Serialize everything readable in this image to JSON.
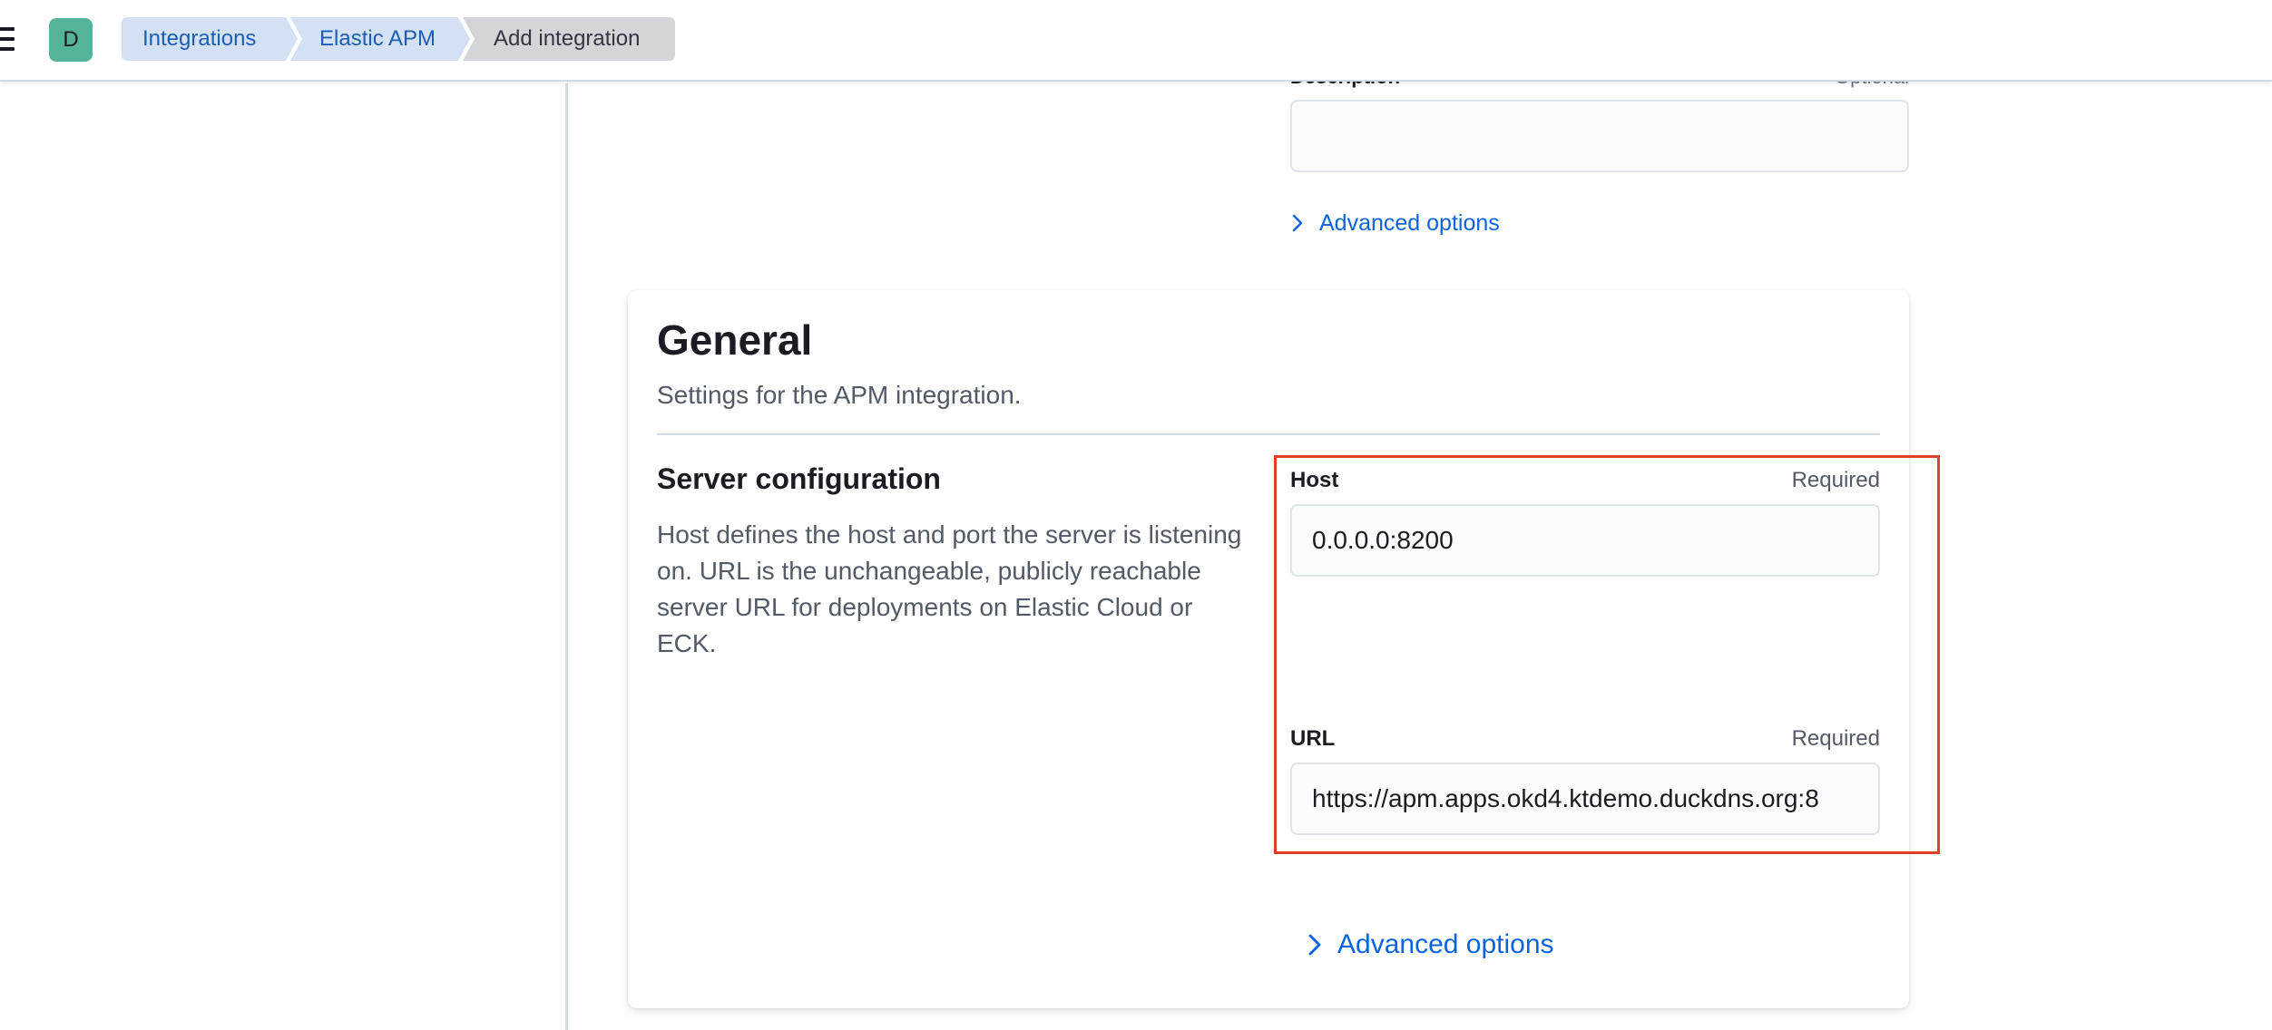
{
  "header": {
    "avatar_initial": "D",
    "breadcrumbs": [
      {
        "label": "Integrations"
      },
      {
        "label": "Elastic APM"
      },
      {
        "label": "Add integration"
      }
    ]
  },
  "description_field": {
    "label": "Description",
    "optional_label": "Optional",
    "value": ""
  },
  "advanced_options_label": "Advanced options",
  "general": {
    "title": "General",
    "subtitle": "Settings for the APM integration.",
    "server_configuration": {
      "title": "Server configuration",
      "description": "Host defines the host and port the server is listening on. URL is the unchangeable, publicly reachable server URL for deployments on Elastic Cloud or ECK.",
      "host": {
        "label": "Host",
        "required_label": "Required",
        "value": "0.0.0.0:8200"
      },
      "url": {
        "label": "URL",
        "required_label": "Required",
        "value": "https://apm.apps.okd4.ktdemo.duckdns.org:8"
      }
    },
    "advanced_options_label": "Advanced options"
  },
  "colors": {
    "breadcrumb_bg": "#d4e1f5",
    "breadcrumb_text": "#1a5fb4",
    "avatar_bg": "#54b399",
    "link": "#0b64dd",
    "highlight_annotation": "#e0402a"
  }
}
